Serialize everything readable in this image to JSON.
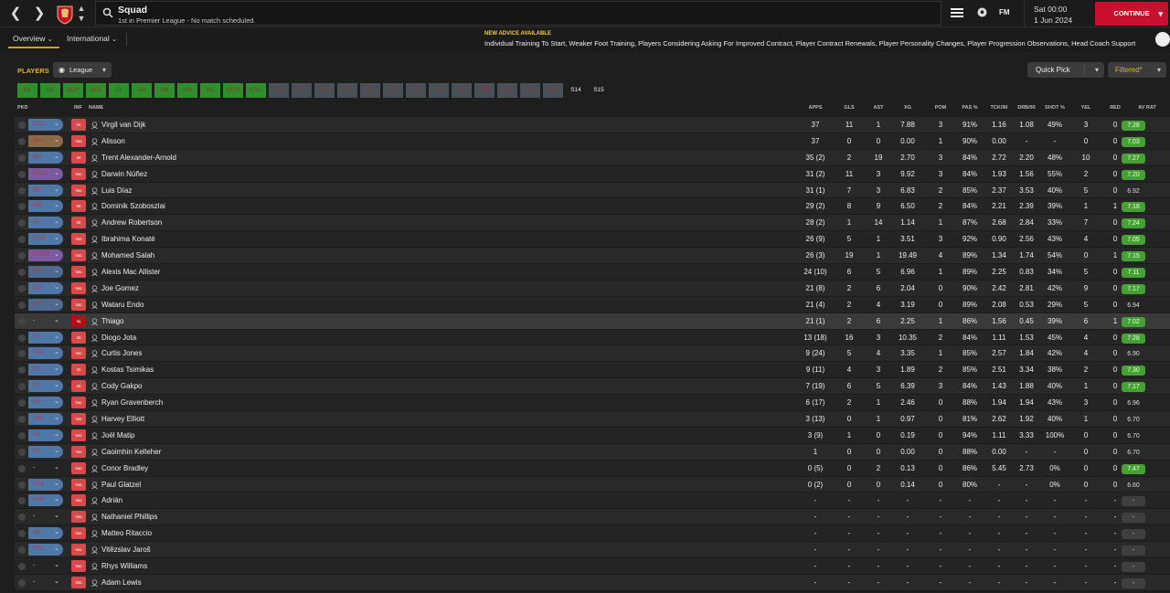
{
  "header": {
    "title": "Squad",
    "subtitle": "1st in Premier League - No match scheduled.",
    "time": "Sat 00:00",
    "date": "1 Jun 2024",
    "continue_label": "CONTINUE",
    "fm_label": "FM"
  },
  "subnav": {
    "tabs": [
      {
        "label": "Overview"
      },
      {
        "label": "International"
      }
    ]
  },
  "advice": {
    "title": "NEW ADVICE AVAILABLE",
    "text": "Individual Training To Start, Weaker Foot Training, Players Considering Asking For Improved Contract, Player Contract Renewals, Player Personality Changes, Player Progression Observations, Head Coach Support"
  },
  "filters": {
    "players_label": "PLAYERS",
    "league_label": "League",
    "quick_pick_label": "Quick Pick",
    "filtered_label": "Filtered*"
  },
  "positions": [
    "GK",
    "DR",
    "DCR",
    "DCL",
    "DL",
    "DM",
    "DM",
    "MR",
    "ML",
    "STCR",
    "STCL",
    "S1",
    "S2",
    "S3",
    "S4",
    "S5",
    "S6",
    "S7",
    "S8",
    "S9",
    "S10",
    "S11",
    "S12",
    "S13",
    "S14",
    "S15"
  ],
  "columns": [
    "PKD",
    "INF",
    "NAME",
    "APPS",
    "GLS",
    "AST",
    "XG",
    "POM",
    "PAS %",
    "TCK/90",
    "DRB/90",
    "SHOT %",
    "YEL",
    "RED",
    "AV RAT"
  ],
  "players": [
    {
      "role": "DCL",
      "inf": "Int",
      "name": "Virgil van Dijk",
      "apps": "37",
      "gls": "11",
      "ast": "1",
      "xg": "7.88",
      "pom": "3",
      "pas": "91%",
      "tck": "1.16",
      "drb": "1.08",
      "shot": "49%",
      "yel": "3",
      "red": "0",
      "rat": "7.28"
    },
    {
      "role": "GK",
      "inf": "Vac",
      "name": "Alisson",
      "apps": "37",
      "gls": "0",
      "ast": "0",
      "xg": "0.00",
      "pom": "1",
      "pas": "90%",
      "tck": "0.00",
      "drb": "-",
      "shot": "-",
      "yel": "0",
      "red": "0",
      "rat": "7.03"
    },
    {
      "role": "DR",
      "inf": "Int",
      "name": "Trent Alexander-Arnold",
      "apps": "35 (2)",
      "gls": "2",
      "ast": "19",
      "xg": "2.70",
      "pom": "3",
      "pas": "84%",
      "tck": "2.72",
      "drb": "2.20",
      "shot": "48%",
      "yel": "10",
      "red": "0",
      "rat": "7.27"
    },
    {
      "role": "STCL",
      "inf": "Vac",
      "name": "Darwin Núñez",
      "apps": "31 (2)",
      "gls": "11",
      "ast": "3",
      "xg": "9.92",
      "pom": "3",
      "pas": "84%",
      "tck": "1.93",
      "drb": "1.56",
      "shot": "55%",
      "yel": "2",
      "red": "0",
      "rat": "7.20"
    },
    {
      "role": "ML",
      "inf": "Vac",
      "name": "Luis Díaz",
      "apps": "31 (1)",
      "gls": "7",
      "ast": "3",
      "xg": "6.83",
      "pom": "2",
      "pas": "85%",
      "tck": "2.37",
      "drb": "3.53",
      "shot": "40%",
      "yel": "5",
      "red": "0",
      "rat": "6.92"
    },
    {
      "role": "MR",
      "inf": "Int",
      "name": "Dominik Szoboszlai",
      "apps": "29 (2)",
      "gls": "8",
      "ast": "9",
      "xg": "6.50",
      "pom": "2",
      "pas": "84%",
      "tck": "2.21",
      "drb": "2.39",
      "shot": "39%",
      "yel": "1",
      "red": "1",
      "rat": "7.18"
    },
    {
      "role": "DL",
      "inf": "Int",
      "name": "Andrew Robertson",
      "apps": "28 (2)",
      "gls": "1",
      "ast": "14",
      "xg": "1.14",
      "pom": "1",
      "pas": "87%",
      "tck": "2.68",
      "drb": "2.84",
      "shot": "33%",
      "yel": "7",
      "red": "0",
      "rat": "7.24"
    },
    {
      "role": "DCR",
      "inf": "Vac",
      "name": "Ibrahima Konaté",
      "apps": "26 (9)",
      "gls": "5",
      "ast": "1",
      "xg": "3.51",
      "pom": "3",
      "pas": "92%",
      "tck": "0.90",
      "drb": "2.56",
      "shot": "43%",
      "yel": "4",
      "red": "0",
      "rat": "7.05"
    },
    {
      "role": "STCR",
      "inf": "Vac",
      "name": "Mohamed Salah",
      "apps": "26 (3)",
      "gls": "19",
      "ast": "1",
      "xg": "19.49",
      "pom": "4",
      "pas": "89%",
      "tck": "1.34",
      "drb": "1.74",
      "shot": "54%",
      "yel": "0",
      "red": "1",
      "rat": "7.15"
    },
    {
      "role": "DM",
      "inf": "Vac",
      "name": "Alexis Mac Allister",
      "apps": "24 (10)",
      "gls": "6",
      "ast": "5",
      "xg": "6.96",
      "pom": "1",
      "pas": "89%",
      "tck": "2.25",
      "drb": "0.83",
      "shot": "34%",
      "yel": "5",
      "red": "0",
      "rat": "7.11"
    },
    {
      "role": "S11",
      "inf": "Vac",
      "name": "Joe Gomez",
      "apps": "21 (8)",
      "gls": "2",
      "ast": "6",
      "xg": "2.04",
      "pom": "0",
      "pas": "90%",
      "tck": "2.42",
      "drb": "2.81",
      "shot": "42%",
      "yel": "9",
      "red": "0",
      "rat": "7.17"
    },
    {
      "role": "DM",
      "inf": "Vac",
      "name": "Wataru Endo",
      "apps": "21 (4)",
      "gls": "2",
      "ast": "4",
      "xg": "3.19",
      "pom": "0",
      "pas": "89%",
      "tck": "2.08",
      "drb": "0.53",
      "shot": "29%",
      "yel": "5",
      "red": "0",
      "rat": "6.94"
    },
    {
      "role": "-",
      "inf": "Inj",
      "name": "Thiago",
      "apps": "21 (1)",
      "gls": "2",
      "ast": "6",
      "xg": "2.25",
      "pom": "1",
      "pas": "86%",
      "tck": "1.56",
      "drb": "0.45",
      "shot": "39%",
      "yel": "6",
      "red": "1",
      "rat": "7.02"
    },
    {
      "role": "S1",
      "inf": "Int",
      "name": "Diogo Jota",
      "apps": "13 (18)",
      "gls": "16",
      "ast": "3",
      "xg": "10.35",
      "pom": "2",
      "pas": "84%",
      "tck": "1.11",
      "drb": "1.53",
      "shot": "45%",
      "yel": "4",
      "red": "0",
      "rat": "7.28"
    },
    {
      "role": "S12",
      "inf": "Vac",
      "name": "Curtis Jones",
      "apps": "9 (24)",
      "gls": "5",
      "ast": "4",
      "xg": "3.35",
      "pom": "1",
      "pas": "85%",
      "tck": "2.57",
      "drb": "1.84",
      "shot": "42%",
      "yel": "4",
      "red": "0",
      "rat": "6.90"
    },
    {
      "role": "S4",
      "inf": "Int",
      "name": "Kostas Tsimikas",
      "apps": "9 (11)",
      "gls": "4",
      "ast": "3",
      "xg": "1.89",
      "pom": "2",
      "pas": "85%",
      "tck": "2.51",
      "drb": "3.34",
      "shot": "38%",
      "yel": "2",
      "red": "0",
      "rat": "7.30"
    },
    {
      "role": "S3",
      "inf": "Int",
      "name": "Cody Gakpo",
      "apps": "7 (19)",
      "gls": "6",
      "ast": "5",
      "xg": "6.39",
      "pom": "3",
      "pas": "84%",
      "tck": "1.43",
      "drb": "1.88",
      "shot": "40%",
      "yel": "1",
      "red": "0",
      "rat": "7.17"
    },
    {
      "role": "S5",
      "inf": "Vac",
      "name": "Ryan Gravenberch",
      "apps": "6 (17)",
      "gls": "2",
      "ast": "1",
      "xg": "2.46",
      "pom": "0",
      "pas": "88%",
      "tck": "1.94",
      "drb": "1.94",
      "shot": "43%",
      "yel": "3",
      "red": "0",
      "rat": "6.96"
    },
    {
      "role": "S10",
      "inf": "Vac",
      "name": "Harvey Elliott",
      "apps": "3 (13)",
      "gls": "0",
      "ast": "1",
      "xg": "0.97",
      "pom": "0",
      "pas": "81%",
      "tck": "2.62",
      "drb": "1.92",
      "shot": "40%",
      "yel": "1",
      "red": "0",
      "rat": "6.70"
    },
    {
      "role": "S8",
      "inf": "Vac",
      "name": "Joël Matip",
      "apps": "3 (9)",
      "gls": "1",
      "ast": "0",
      "xg": "0.19",
      "pom": "0",
      "pas": "94%",
      "tck": "1.11",
      "drb": "3.33",
      "shot": "100%",
      "yel": "0",
      "red": "0",
      "rat": "6.70"
    },
    {
      "role": "S2",
      "inf": "Vac",
      "name": "Caoimhin Kelleher",
      "apps": "1",
      "gls": "0",
      "ast": "0",
      "xg": "0.00",
      "pom": "0",
      "pas": "88%",
      "tck": "0.00",
      "drb": "-",
      "shot": "-",
      "yel": "0",
      "red": "0",
      "rat": "6.70"
    },
    {
      "role": "-",
      "inf": "Vac",
      "name": "Conor Bradley",
      "apps": "0 (5)",
      "gls": "0",
      "ast": "2",
      "xg": "0.13",
      "pom": "0",
      "pas": "86%",
      "tck": "5.45",
      "drb": "2.73",
      "shot": "0%",
      "yel": "0",
      "red": "0",
      "rat": "7.47"
    },
    {
      "role": "S13",
      "inf": "Vac",
      "name": "Paul Glatzel",
      "apps": "0 (2)",
      "gls": "0",
      "ast": "0",
      "xg": "0.14",
      "pom": "0",
      "pas": "80%",
      "tck": "-",
      "drb": "-",
      "shot": "0%",
      "yel": "0",
      "red": "0",
      "rat": "6.60"
    },
    {
      "role": "S14",
      "inf": "Vac",
      "name": "Adrián",
      "apps": "-",
      "gls": "-",
      "ast": "-",
      "xg": "-",
      "pom": "-",
      "pas": "-",
      "tck": "-",
      "drb": "-",
      "shot": "-",
      "yel": "-",
      "red": "-",
      "rat": "-"
    },
    {
      "role": "-",
      "inf": "Vac",
      "name": "Nathaniel Phillips",
      "apps": "-",
      "gls": "-",
      "ast": "-",
      "xg": "-",
      "pom": "-",
      "pas": "-",
      "tck": "-",
      "drb": "-",
      "shot": "-",
      "yel": "-",
      "red": "-",
      "rat": "-"
    },
    {
      "role": "S6",
      "inf": "Vac",
      "name": "Matteo Ritaccio",
      "apps": "-",
      "gls": "-",
      "ast": "-",
      "xg": "-",
      "pom": "-",
      "pas": "-",
      "tck": "-",
      "drb": "-",
      "shot": "-",
      "yel": "-",
      "red": "-",
      "rat": "-"
    },
    {
      "role": "S15",
      "inf": "Vac",
      "name": "Vitězslav Jaroš",
      "apps": "-",
      "gls": "-",
      "ast": "-",
      "xg": "-",
      "pom": "-",
      "pas": "-",
      "tck": "-",
      "drb": "-",
      "shot": "-",
      "yel": "-",
      "red": "-",
      "rat": "-"
    },
    {
      "role": "-",
      "inf": "Vac",
      "name": "Rhys Williams",
      "apps": "-",
      "gls": "-",
      "ast": "-",
      "xg": "-",
      "pom": "-",
      "pas": "-",
      "tck": "-",
      "drb": "-",
      "shot": "-",
      "yel": "-",
      "red": "-",
      "rat": "-"
    },
    {
      "role": "-",
      "inf": "Vac",
      "name": "Adam Lewis",
      "apps": "-",
      "gls": "-",
      "ast": "-",
      "xg": "-",
      "pom": "-",
      "pas": "-",
      "tck": "-",
      "drb": "-",
      "shot": "-",
      "yel": "-",
      "red": "-",
      "rat": "-"
    }
  ],
  "colors": {
    "accent_red": "#c8102e",
    "accent_gold": "#e0b020",
    "rating_green": "#46a135"
  }
}
